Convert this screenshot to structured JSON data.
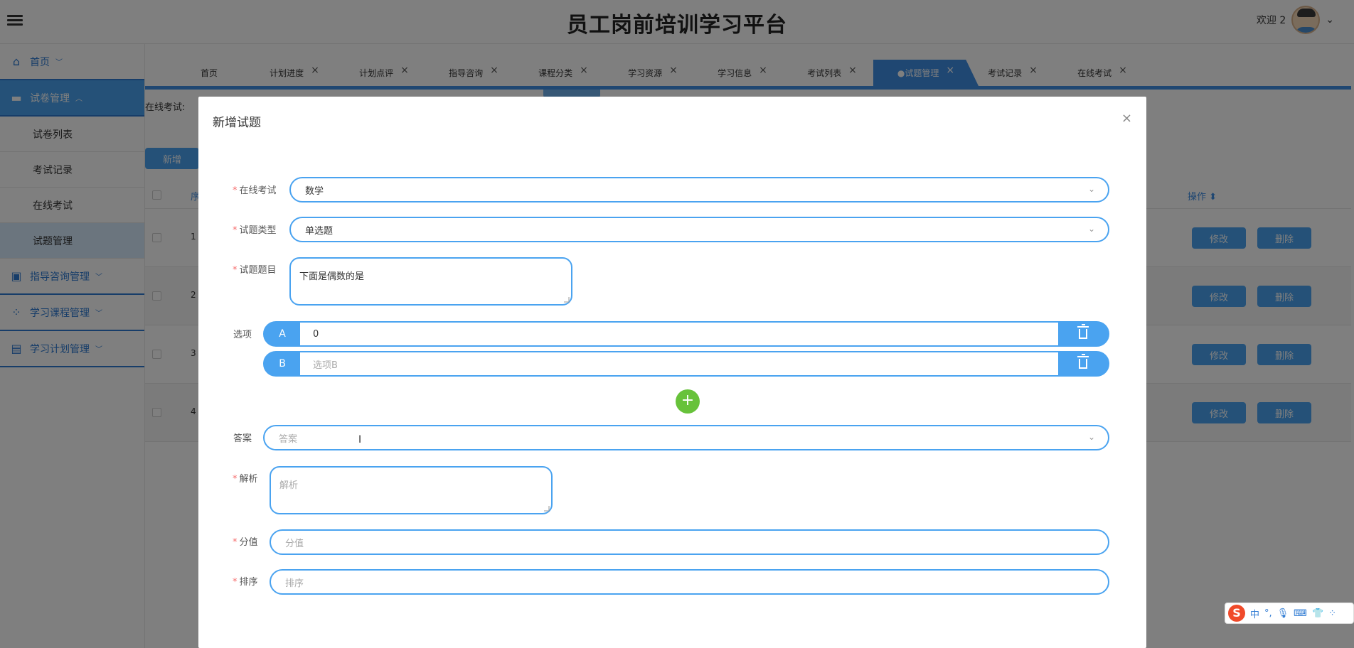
{
  "header": {
    "title": "员工岗前培训学习平台",
    "welcome": "欢迎 2",
    "chevron": "⌄"
  },
  "sidebar": {
    "items": [
      {
        "label": "首页",
        "icon": "home-icon"
      },
      {
        "label": "试卷管理",
        "icon": "paper-icon"
      },
      {
        "label": "指导咨询管理",
        "icon": "briefcase-icon"
      },
      {
        "label": "学习课程管理",
        "icon": "grid-icon"
      },
      {
        "label": "学习计划管理",
        "icon": "book-icon"
      }
    ],
    "subitems": [
      "试卷列表",
      "考试记录",
      "在线考试",
      "试题管理"
    ]
  },
  "tabs": [
    {
      "label": "首页",
      "closable": false
    },
    {
      "label": "计划进度",
      "closable": true
    },
    {
      "label": "计划点评",
      "closable": true
    },
    {
      "label": "指导咨询",
      "closable": true
    },
    {
      "label": "课程分类",
      "closable": true
    },
    {
      "label": "学习资源",
      "closable": true
    },
    {
      "label": "学习信息",
      "closable": true
    },
    {
      "label": "考试列表",
      "closable": true
    },
    {
      "label": "●试题管理",
      "closable": true,
      "active": true
    },
    {
      "label": "考试记录",
      "closable": true
    },
    {
      "label": "在线考试",
      "closable": true
    }
  ],
  "page": {
    "filter_label": "在线考试:",
    "add_button": "新增",
    "col_index": "序",
    "col_ops": "操作 ⬍",
    "rows": [
      {
        "index": "1",
        "edit": "修改",
        "delete": "删除"
      },
      {
        "index": "2",
        "edit": "修改",
        "delete": "删除"
      },
      {
        "index": "3",
        "edit": "修改",
        "delete": "删除"
      },
      {
        "index": "4",
        "edit": "修改",
        "delete": "删除"
      }
    ]
  },
  "dialog": {
    "title": "新增试题",
    "close": "×",
    "exam_label": "在线考试",
    "exam_value": "数学",
    "type_label": "试题类型",
    "type_value": "单选题",
    "question_label": "试题题目",
    "question_value": "下面是偶数的是",
    "options_label": "选项",
    "options": [
      {
        "letter": "A",
        "value": "0",
        "placeholder": ""
      },
      {
        "letter": "B",
        "value": "",
        "placeholder": "选项B"
      }
    ],
    "add_option": "+",
    "answer_label": "答案",
    "answer_placeholder": "答案",
    "analysis_label": "解析",
    "analysis_placeholder": "解析",
    "score_label": "分值",
    "score_placeholder": "分值",
    "sort_label": "排序",
    "sort_placeholder": "排序",
    "required_mark": "*",
    "dropdown_arrow": "⌄"
  },
  "ime": {
    "logo": "S",
    "lang": "中",
    "punct": "°,"
  },
  "colors": {
    "accent": "#4aa3f0",
    "tab_active": "#3f8ee4",
    "add_green": "#67c23a",
    "required": "#f56c6c"
  }
}
